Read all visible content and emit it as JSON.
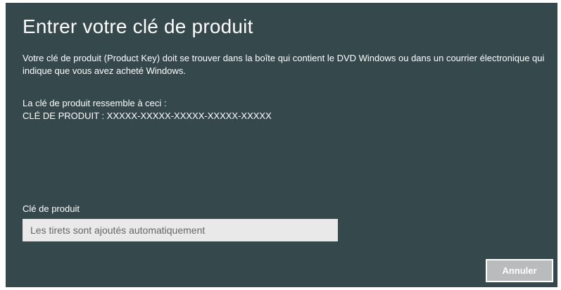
{
  "dialog": {
    "title": "Entrer votre clé de produit",
    "description": "Votre clé de produit (Product Key) doit se trouver dans la boîte qui contient le DVD Windows ou dans un courrier électronique qui indique que vous avez acheté Windows.",
    "example_intro": "La clé de produit ressemble à ceci :",
    "example_key": "CLÉ DE PRODUIT : XXXXX-XXXXX-XXXXX-XXXXX-XXXXX",
    "field_label": "Clé de produit",
    "field_placeholder": "Les tirets sont ajoutés automatiquement",
    "field_value": "",
    "cancel_label": "Annuler"
  },
  "colors": {
    "dialog_background": "#35484c",
    "text": "#ffffff",
    "input_background": "#e9e9e9",
    "button_background": "#b8bcbc"
  }
}
